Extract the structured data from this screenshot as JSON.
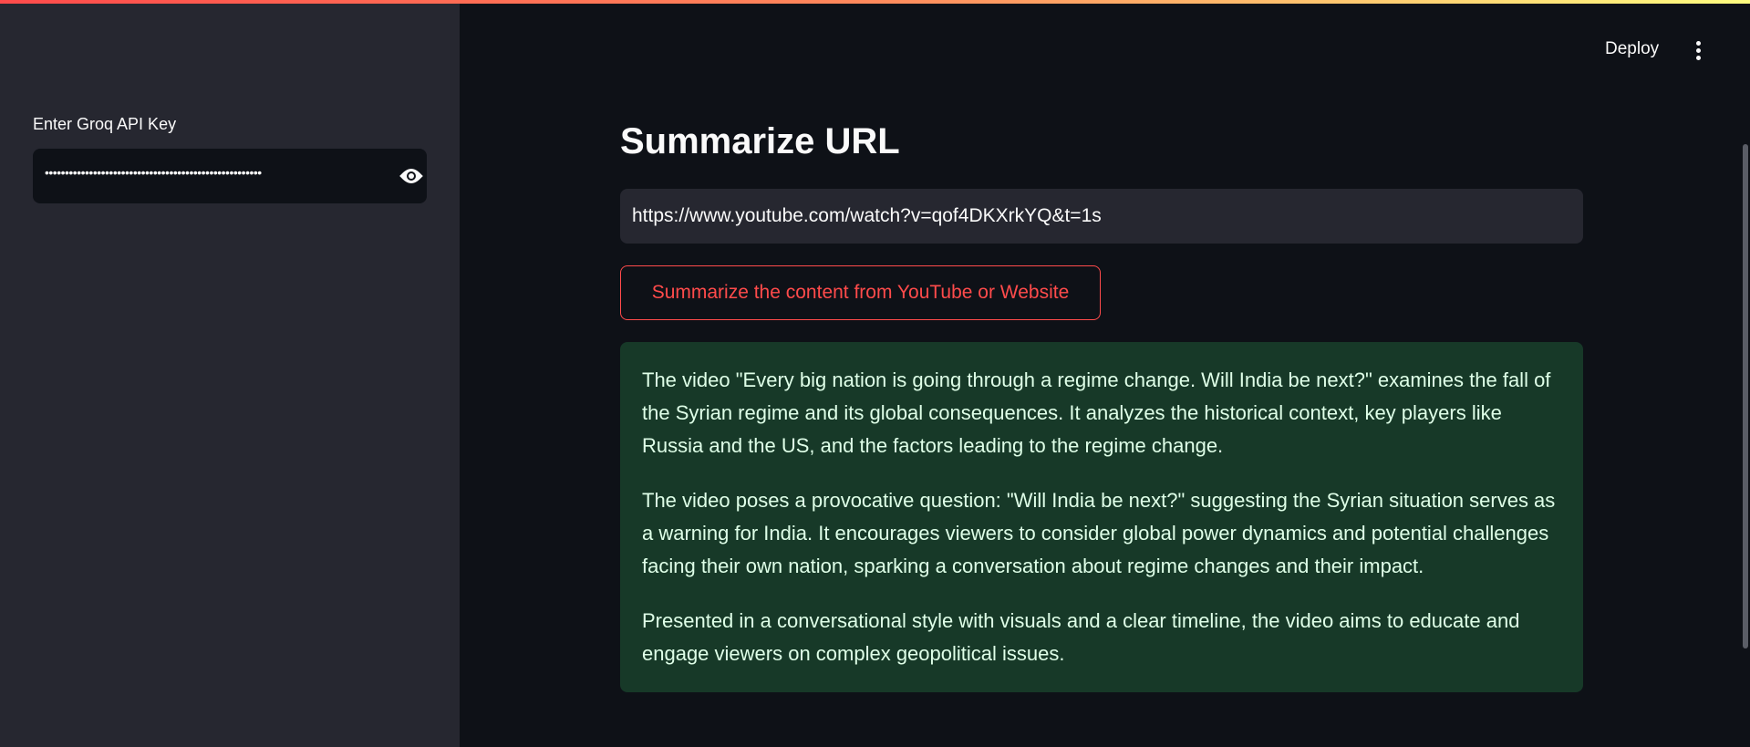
{
  "sidebar": {
    "api_key_label": "Enter Groq API Key",
    "api_key_masked": "••••••••••••••••••••••••••••••••••••••••••••••••••••••"
  },
  "header": {
    "deploy_label": "Deploy"
  },
  "main": {
    "title": "Summarize URL",
    "url_value": "https://www.youtube.com/watch?v=qof4DKXrkYQ&t=1s",
    "button_label": "Summarize the content from YouTube or Website",
    "summary_paragraphs": [
      "The video \"Every big nation is going through a regime change. Will India be next?\" examines the fall of the Syrian regime and its global consequences. It analyzes the historical context, key players like Russia and the US, and the factors leading to the regime change.",
      "The video poses a provocative question: \"Will India be next?\" suggesting the Syrian situation serves as a warning for India. It encourages viewers to consider global power dynamics and potential challenges facing their own nation, sparking a conversation about regime changes and their impact.",
      "Presented in a conversational style with visuals and a clear timeline, the video aims to educate and engage viewers on complex geopolitical issues."
    ]
  },
  "colors": {
    "accent": "#ff4b4b",
    "background": "#0e1117",
    "sidebar": "#262730",
    "success_bg": "#173928"
  },
  "icons": {
    "show_password": "eye-icon",
    "menu": "kebab-menu-icon"
  }
}
